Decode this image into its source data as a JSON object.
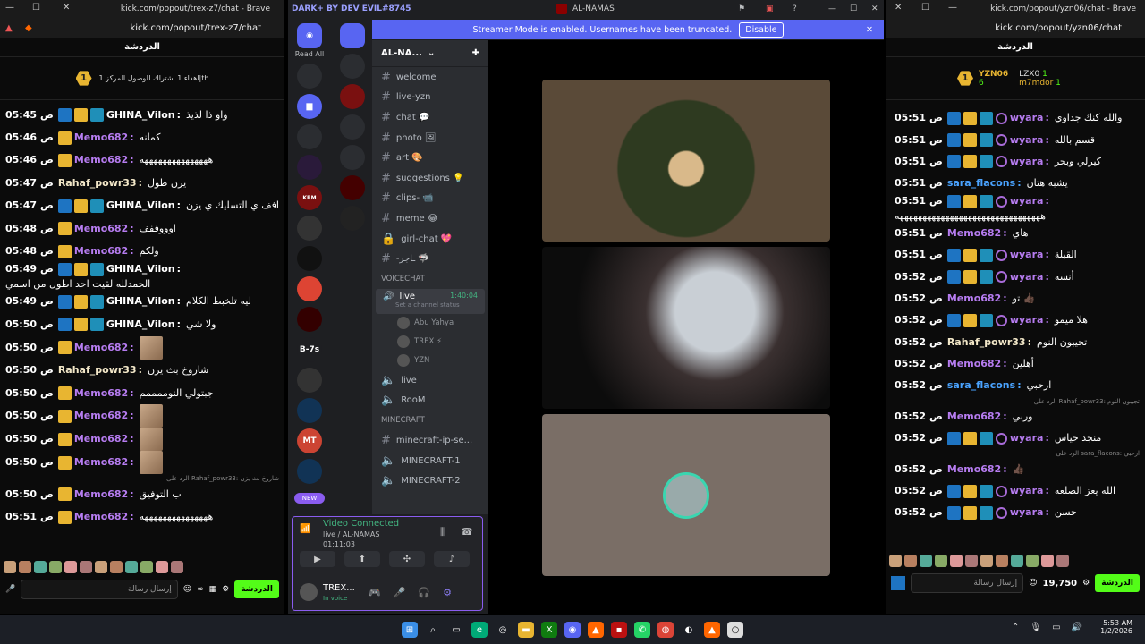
{
  "left": {
    "title": "kick.com/popout/trex-z7/chat - Brave",
    "url": "kick.com/popout/trex-z7/chat",
    "header": "الدردشة",
    "pinned": "اهداء 1 اشتراك للوصول المركز 1|th",
    "pinned_rank": "1",
    "messages": [
      {
        "time": "05:45",
        "user": "GHINA_Vilon",
        "color": "#ffffff",
        "badges": [
          "mod",
          "crown",
          "og"
        ],
        "text": "واو ذا لذيذ"
      },
      {
        "time": "05:46",
        "user": "Memo682",
        "color": "#b67cf0",
        "badges": [
          "crown"
        ],
        "text": "كمانه"
      },
      {
        "time": "05:46",
        "user": "Memo682",
        "color": "#b67cf0",
        "badges": [
          "crown"
        ],
        "text": "هههههههههههههههه"
      },
      {
        "time": "05:47",
        "user": "Rahaf_powr33",
        "color": "#f2e7c8",
        "badges": [],
        "text": "يزن طول"
      },
      {
        "time": "05:47",
        "user": "GHINA_Vilon",
        "color": "#ffffff",
        "badges": [
          "mod",
          "crown",
          "og"
        ],
        "text": "افف ي التسليك ي يزن"
      },
      {
        "time": "05:48",
        "user": "Memo682",
        "color": "#b67cf0",
        "badges": [
          "crown"
        ],
        "text": "اوووففف"
      },
      {
        "time": "05:48",
        "user": "Memo682",
        "color": "#b67cf0",
        "badges": [
          "crown"
        ],
        "text": "ولكم"
      },
      {
        "time": "05:49",
        "user": "GHINA_Vilon",
        "color": "#ffffff",
        "badges": [
          "mod",
          "crown",
          "og"
        ],
        "text": "الحمدلله لقيت احد اطول من اسمي"
      },
      {
        "time": "05:49",
        "user": "GHINA_Vilon",
        "color": "#ffffff",
        "badges": [
          "mod",
          "crown",
          "og"
        ],
        "text": "ليه تلخبط الكلام"
      },
      {
        "time": "05:50",
        "user": "GHINA_Vilon",
        "color": "#ffffff",
        "badges": [
          "mod",
          "crown",
          "og"
        ],
        "text": "ولا شي"
      },
      {
        "time": "05:50",
        "user": "Memo682",
        "color": "#b67cf0",
        "badges": [
          "crown"
        ],
        "text": "",
        "emote": true
      },
      {
        "time": "05:50",
        "user": "Rahaf_powr33",
        "color": "#f2e7c8",
        "badges": [],
        "text": "شاروخ بث يزن"
      },
      {
        "time": "05:50",
        "user": "Memo682",
        "color": "#b67cf0",
        "badges": [
          "crown"
        ],
        "text": "جبتولي النوممممم"
      },
      {
        "time": "05:50",
        "user": "Memo682",
        "color": "#b67cf0",
        "badges": [
          "crown"
        ],
        "text": "",
        "emote": true
      },
      {
        "time": "05:50",
        "user": "Memo682",
        "color": "#b67cf0",
        "badges": [
          "crown"
        ],
        "text": "",
        "emote": true
      },
      {
        "time": "05:50",
        "user": "Memo682",
        "color": "#b67cf0",
        "badges": [
          "crown"
        ],
        "text": "",
        "emote": true
      },
      {
        "time": "05:50",
        "user": "Memo682",
        "color": "#b67cf0",
        "badges": [
          "crown"
        ],
        "text": "ب التوفيق",
        "reply": "الرد على Rahaf_powr33: شاروخ بث يزن"
      },
      {
        "time": "05:51",
        "user": "Memo682",
        "color": "#b67cf0",
        "badges": [
          "crown"
        ],
        "text": "هههههههههههههههه"
      }
    ],
    "input_placeholder": "إرسال رسالة",
    "chat_button": "الدردشة"
  },
  "discord": {
    "brand": "DARK+ BY DEV EVIL#8745",
    "window_title": "AL-NAMAS",
    "banner": "Streamer Mode is enabled. Usernames have been truncated.",
    "banner_btn": "Disable",
    "read_all": "Read All",
    "server_name": "AL-NA...",
    "channels": [
      "welcome",
      "live-yzn",
      "chat 💬",
      "photo 🖼",
      "art 🎨",
      "suggestions 💡",
      "clips- 📹",
      "meme 😂",
      "girl-chat 💖",
      "-ـاجر 🦈"
    ],
    "voice_cat": "VOICECHAT",
    "live_channel": "live",
    "live_time": "1:40:04",
    "live_status": "Set a channel status",
    "voice_users": [
      "Abu Yahya",
      "TREX ⚡",
      "YZN"
    ],
    "other_voice": [
      "live",
      "RooM"
    ],
    "mc_cat": "MINECRAFT",
    "mc_channels": [
      "minecraft-ip-se...",
      "MINECRAFT-1",
      "MINECRAFT-2"
    ],
    "guild_labels": [
      "B-7s",
      "KRM",
      "MT"
    ],
    "new_badge": "NEW",
    "vc_title": "Video Connected",
    "vc_sub": "live / AL-NAMAS",
    "vc_time": "01:11:03",
    "user_name": "TREX...",
    "user_status": "In voice"
  },
  "right": {
    "title": "kick.com/popout/yzn06/chat - Brave",
    "url": "kick.com/popout/yzn06/chat",
    "header": "الدردشة",
    "top1": "YZN06",
    "top1_n": "6",
    "top2": "LZX0",
    "top2_n": "1",
    "top3": "m7mdor",
    "top3_n": "1",
    "messages": [
      {
        "time": "05:51",
        "user": "wyara",
        "color": "#b67cf0",
        "badges": [
          "mod",
          "crown",
          "og",
          "ring"
        ],
        "text": "والله كنك جداوي"
      },
      {
        "time": "05:51",
        "user": "wyara",
        "color": "#b67cf0",
        "badges": [
          "mod",
          "crown",
          "og",
          "ring"
        ],
        "text": "قسم بالله"
      },
      {
        "time": "05:51",
        "user": "wyara",
        "color": "#b67cf0",
        "badges": [
          "mod",
          "crown",
          "og",
          "ring"
        ],
        "text": "كيرلي وبحر"
      },
      {
        "time": "05:51",
        "user": "sara_flacons",
        "color": "#4aa3ff",
        "badges": [],
        "text": "يشبه هتان"
      },
      {
        "time": "05:51",
        "user": "wyara",
        "color": "#b67cf0",
        "badges": [
          "mod",
          "crown",
          "og",
          "ring"
        ],
        "text": "ههههههههههههههههههههههههههههههههه"
      },
      {
        "time": "05:51",
        "user": "Memo682",
        "color": "#b67cf0",
        "badges": [],
        "text": "هاي"
      },
      {
        "time": "05:51",
        "user": "wyara",
        "color": "#b67cf0",
        "badges": [
          "mod",
          "crown",
          "og",
          "ring"
        ],
        "text": "القبلة"
      },
      {
        "time": "05:52",
        "user": "wyara",
        "color": "#b67cf0",
        "badges": [
          "mod",
          "crown",
          "og",
          "ring"
        ],
        "text": "أنسه"
      },
      {
        "time": "05:52",
        "user": "Memo682",
        "color": "#b67cf0",
        "badges": [],
        "text": "تو 👍🏿"
      },
      {
        "time": "05:52",
        "user": "wyara",
        "color": "#b67cf0",
        "badges": [
          "mod",
          "crown",
          "og",
          "ring"
        ],
        "text": "هلا ميمو"
      },
      {
        "time": "05:52",
        "user": "Rahaf_powr33",
        "color": "#f2e7c8",
        "badges": [],
        "text": "تجيبون النوم"
      },
      {
        "time": "05:52",
        "user": "Memo682",
        "color": "#b67cf0",
        "badges": [],
        "text": "أهلين"
      },
      {
        "time": "05:52",
        "user": "sara_flacons",
        "color": "#4aa3ff",
        "badges": [],
        "text": "ارحبي"
      },
      {
        "time": "05:52",
        "user": "Memo682",
        "color": "#b67cf0",
        "badges": [],
        "text": "وربي",
        "reply": "الرد على Rahaf_powr33: تجيبون النوم"
      },
      {
        "time": "05:52",
        "user": "wyara",
        "color": "#b67cf0",
        "badges": [
          "mod",
          "crown",
          "og",
          "ring"
        ],
        "text": "منجد خياس"
      },
      {
        "time": "05:52",
        "user": "Memo682",
        "color": "#b67cf0",
        "badges": [],
        "text": "👍🏿",
        "reply": "الرد على sara_flacons: ارحبي"
      },
      {
        "time": "05:52",
        "user": "wyara",
        "color": "#b67cf0",
        "badges": [
          "mod",
          "crown",
          "og",
          "ring"
        ],
        "text": "الله يعز الصلعه"
      },
      {
        "time": "05:52",
        "user": "wyara",
        "color": "#b67cf0",
        "badges": [
          "mod",
          "crown",
          "og",
          "ring"
        ],
        "text": "حسن"
      }
    ],
    "input_placeholder": "إرسال رسالة",
    "points": "19,750",
    "chat_button": "الدردشة"
  },
  "taskbar": {
    "time": "5:53 AM",
    "date": "1/2/2026"
  }
}
